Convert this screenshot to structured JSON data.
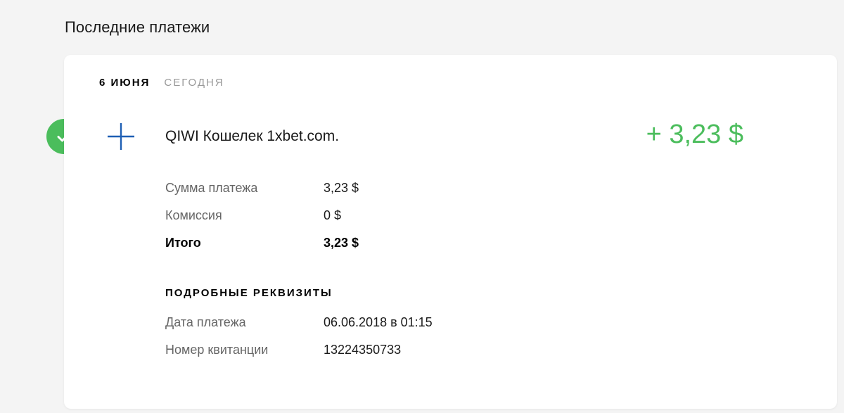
{
  "page": {
    "title": "Последние платежи"
  },
  "group": {
    "date": "6 июня",
    "relative": "Сегодня"
  },
  "payment": {
    "name": "QIWI Кошелек 1xbet.com.",
    "amount": "+ 3,23 $",
    "status_icon": "check-icon",
    "type_icon": "plus-icon"
  },
  "summary": [
    {
      "label": "Сумма платежа",
      "value": "3,23 $"
    },
    {
      "label": "Комиссия",
      "value": "0 $"
    },
    {
      "label": "Итого",
      "value": "3,23 $"
    }
  ],
  "requisites": {
    "title": "Подробные реквизиты",
    "rows": [
      {
        "label": "Дата платежа",
        "value": "06.06.2018 в 01:15"
      },
      {
        "label": "Номер квитанции",
        "value": "13224350733"
      }
    ]
  },
  "colors": {
    "accent_green": "#4bbd5c",
    "plus_blue": "#1e5fb4",
    "background": "#f4f4f4",
    "card": "#ffffff"
  }
}
